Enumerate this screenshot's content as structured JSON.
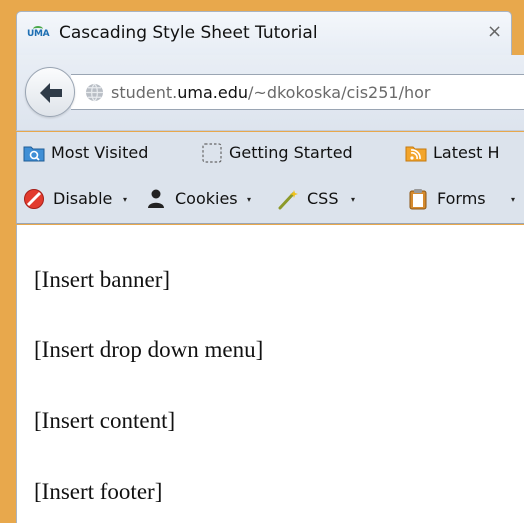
{
  "tab": {
    "favicon_text": "UMA",
    "title": "Cascading Style Sheet Tutorial",
    "close_glyph": "×"
  },
  "nav": {
    "url_prefix": "student.",
    "url_host": "uma.edu",
    "url_path": "/~dkokoska/cis251/hor"
  },
  "bookmarks": {
    "items": [
      {
        "label": "Most Visited",
        "icon": "most-visited-folder-icon"
      },
      {
        "label": "Getting Started",
        "icon": "dashed-page-icon"
      },
      {
        "label": "Latest H",
        "icon": "rss-feed-icon"
      }
    ]
  },
  "dev_toolbar": {
    "items": [
      {
        "label": "Disable",
        "icon": "disable-icon"
      },
      {
        "label": "Cookies",
        "icon": "cookies-icon"
      },
      {
        "label": "CSS",
        "icon": "css-wand-icon"
      },
      {
        "label": "Forms",
        "icon": "forms-clipboard-icon"
      }
    ],
    "caret": "▾"
  },
  "page": {
    "lines": [
      "[Insert banner]",
      "[Insert drop down menu]",
      "[Insert content]",
      "[Insert footer]"
    ]
  },
  "colors": {
    "window_frame": "#e8a84c",
    "content_bg": "#ffffff",
    "toolbar_bg": "#dce3ec"
  }
}
